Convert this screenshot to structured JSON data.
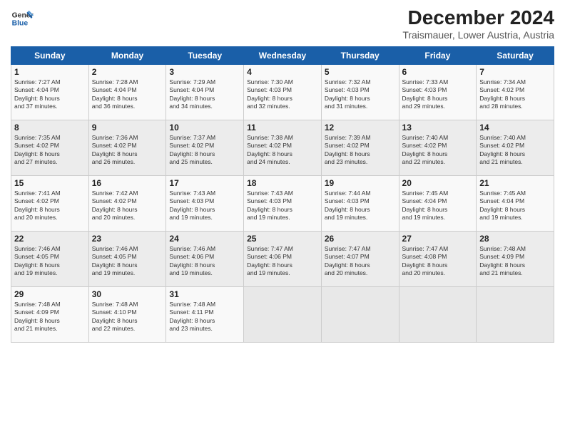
{
  "logo": {
    "general": "General",
    "blue": "Blue",
    "tagline": ""
  },
  "title": "December 2024",
  "subtitle": "Traismauer, Lower Austria, Austria",
  "weekdays": [
    "Sunday",
    "Monday",
    "Tuesday",
    "Wednesday",
    "Thursday",
    "Friday",
    "Saturday"
  ],
  "weeks": [
    [
      {
        "day": "1",
        "info": "Sunrise: 7:27 AM\nSunset: 4:04 PM\nDaylight: 8 hours\nand 37 minutes."
      },
      {
        "day": "2",
        "info": "Sunrise: 7:28 AM\nSunset: 4:04 PM\nDaylight: 8 hours\nand 36 minutes."
      },
      {
        "day": "3",
        "info": "Sunrise: 7:29 AM\nSunset: 4:04 PM\nDaylight: 8 hours\nand 34 minutes."
      },
      {
        "day": "4",
        "info": "Sunrise: 7:30 AM\nSunset: 4:03 PM\nDaylight: 8 hours\nand 32 minutes."
      },
      {
        "day": "5",
        "info": "Sunrise: 7:32 AM\nSunset: 4:03 PM\nDaylight: 8 hours\nand 31 minutes."
      },
      {
        "day": "6",
        "info": "Sunrise: 7:33 AM\nSunset: 4:03 PM\nDaylight: 8 hours\nand 29 minutes."
      },
      {
        "day": "7",
        "info": "Sunrise: 7:34 AM\nSunset: 4:02 PM\nDaylight: 8 hours\nand 28 minutes."
      }
    ],
    [
      {
        "day": "8",
        "info": "Sunrise: 7:35 AM\nSunset: 4:02 PM\nDaylight: 8 hours\nand 27 minutes."
      },
      {
        "day": "9",
        "info": "Sunrise: 7:36 AM\nSunset: 4:02 PM\nDaylight: 8 hours\nand 26 minutes."
      },
      {
        "day": "10",
        "info": "Sunrise: 7:37 AM\nSunset: 4:02 PM\nDaylight: 8 hours\nand 25 minutes."
      },
      {
        "day": "11",
        "info": "Sunrise: 7:38 AM\nSunset: 4:02 PM\nDaylight: 8 hours\nand 24 minutes."
      },
      {
        "day": "12",
        "info": "Sunrise: 7:39 AM\nSunset: 4:02 PM\nDaylight: 8 hours\nand 23 minutes."
      },
      {
        "day": "13",
        "info": "Sunrise: 7:40 AM\nSunset: 4:02 PM\nDaylight: 8 hours\nand 22 minutes."
      },
      {
        "day": "14",
        "info": "Sunrise: 7:40 AM\nSunset: 4:02 PM\nDaylight: 8 hours\nand 21 minutes."
      }
    ],
    [
      {
        "day": "15",
        "info": "Sunrise: 7:41 AM\nSunset: 4:02 PM\nDaylight: 8 hours\nand 20 minutes."
      },
      {
        "day": "16",
        "info": "Sunrise: 7:42 AM\nSunset: 4:02 PM\nDaylight: 8 hours\nand 20 minutes."
      },
      {
        "day": "17",
        "info": "Sunrise: 7:43 AM\nSunset: 4:03 PM\nDaylight: 8 hours\nand 19 minutes."
      },
      {
        "day": "18",
        "info": "Sunrise: 7:43 AM\nSunset: 4:03 PM\nDaylight: 8 hours\nand 19 minutes."
      },
      {
        "day": "19",
        "info": "Sunrise: 7:44 AM\nSunset: 4:03 PM\nDaylight: 8 hours\nand 19 minutes."
      },
      {
        "day": "20",
        "info": "Sunrise: 7:45 AM\nSunset: 4:04 PM\nDaylight: 8 hours\nand 19 minutes."
      },
      {
        "day": "21",
        "info": "Sunrise: 7:45 AM\nSunset: 4:04 PM\nDaylight: 8 hours\nand 19 minutes."
      }
    ],
    [
      {
        "day": "22",
        "info": "Sunrise: 7:46 AM\nSunset: 4:05 PM\nDaylight: 8 hours\nand 19 minutes."
      },
      {
        "day": "23",
        "info": "Sunrise: 7:46 AM\nSunset: 4:05 PM\nDaylight: 8 hours\nand 19 minutes."
      },
      {
        "day": "24",
        "info": "Sunrise: 7:46 AM\nSunset: 4:06 PM\nDaylight: 8 hours\nand 19 minutes."
      },
      {
        "day": "25",
        "info": "Sunrise: 7:47 AM\nSunset: 4:06 PM\nDaylight: 8 hours\nand 19 minutes."
      },
      {
        "day": "26",
        "info": "Sunrise: 7:47 AM\nSunset: 4:07 PM\nDaylight: 8 hours\nand 20 minutes."
      },
      {
        "day": "27",
        "info": "Sunrise: 7:47 AM\nSunset: 4:08 PM\nDaylight: 8 hours\nand 20 minutes."
      },
      {
        "day": "28",
        "info": "Sunrise: 7:48 AM\nSunset: 4:09 PM\nDaylight: 8 hours\nand 21 minutes."
      }
    ],
    [
      {
        "day": "29",
        "info": "Sunrise: 7:48 AM\nSunset: 4:09 PM\nDaylight: 8 hours\nand 21 minutes."
      },
      {
        "day": "30",
        "info": "Sunrise: 7:48 AM\nSunset: 4:10 PM\nDaylight: 8 hours\nand 22 minutes."
      },
      {
        "day": "31",
        "info": "Sunrise: 7:48 AM\nSunset: 4:11 PM\nDaylight: 8 hours\nand 23 minutes."
      },
      {
        "day": "",
        "info": ""
      },
      {
        "day": "",
        "info": ""
      },
      {
        "day": "",
        "info": ""
      },
      {
        "day": "",
        "info": ""
      }
    ]
  ]
}
